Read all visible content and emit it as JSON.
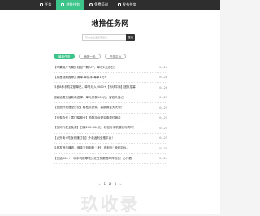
{
  "nav": {
    "items": [
      {
        "label": "任务",
        "icon": "home-icon",
        "active": false
      },
      {
        "label": "地推任务",
        "icon": "tasks-icon",
        "active": true
      },
      {
        "label": "免费培训",
        "icon": "person-icon",
        "active": false
      },
      {
        "label": "发布任务",
        "icon": "publish-icon",
        "active": false
      }
    ]
  },
  "site": {
    "title": "地推任务网"
  },
  "search": {
    "placeholder": "可以在这里搜索任务",
    "button": "搜索"
  },
  "tabs": [
    {
      "label": "最新任务",
      "active": true
    },
    {
      "label": "地推一手",
      "active": false
    },
    {
      "label": "任务平台",
      "active": false
    }
  ],
  "list": [
    {
      "title": "【苹果用户专属】轻松下载APP，单次2元左右！",
      "date": "04-26"
    },
    {
      "title": "【抖音视频推荐】简单-单成本-每单1元+",
      "date": "04-26"
    },
    {
      "title": "抖音8秒手机发航单已，单号月入2000+【有块平商】团队招募",
      "date": "04-26"
    },
    {
      "title": "超级话费充值新商选择：单元开发100元，省钱又省心！",
      "date": "04-25"
    },
    {
      "title": "【美团外卖首全日记】轻松点外卖，高额佣金天天领！",
      "date": "04-25"
    },
    {
      "title": "【优惠合作｜零门槛副业】购物平台好实惠领付佣金",
      "date": "04-25"
    },
    {
      "title": "【快码代发全免费】日赚200-300元，轻松与手机赚钱与同时！",
      "date": "04-25"
    },
    {
      "title": "【点外卖+吃饭领赚红包】外卖返利全推平台！",
      "date": "04-25"
    },
    {
      "title": "抖音发音乐赚钱，佣金立刻到帐 '1秒，得利元' 维修平台。",
      "date": "04-25"
    },
    {
      "title": "【已结300+】玩手机赚零钱分红任务跟着邮件钱包！心门看",
      "date": "04-24"
    }
  ],
  "pagination": [
    "«",
    "1",
    "2",
    "3",
    "»"
  ],
  "watermark": "玖收录"
}
